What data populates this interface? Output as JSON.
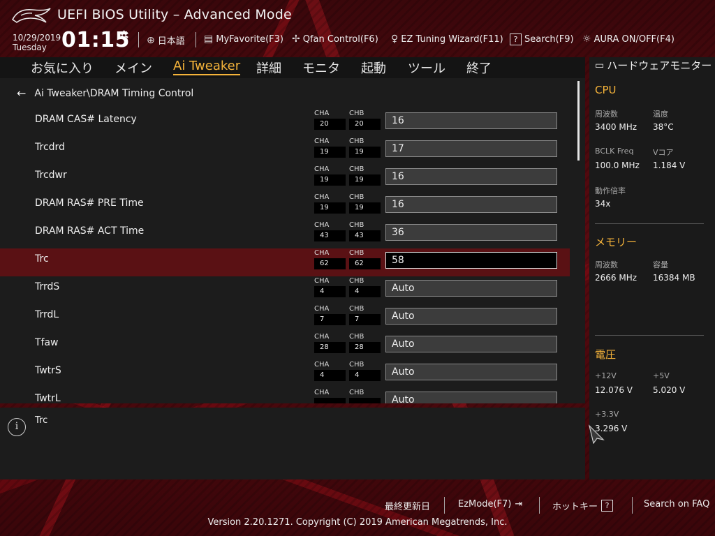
{
  "header": {
    "title": "UEFI BIOS Utility – Advanced Mode",
    "date": "10/29/2019",
    "day": "Tuesday",
    "time": "01:15",
    "tools": [
      {
        "icon": "globe-icon",
        "label": "日本語"
      },
      {
        "icon": "favorite-icon",
        "label": "MyFavorite(F3)"
      },
      {
        "icon": "fan-icon",
        "label": "Qfan Control(F6)"
      },
      {
        "icon": "lightbulb-icon",
        "label": "EZ Tuning Wizard(F11)"
      },
      {
        "icon": "help-box-icon",
        "label": "Search(F9)"
      },
      {
        "icon": "aura-icon",
        "label": "AURA ON/OFF(F4)"
      }
    ]
  },
  "tabs": [
    "お気に入り",
    "メイン",
    "Ai Tweaker",
    "詳細",
    "モニタ",
    "起動",
    "ツール",
    "終了"
  ],
  "active_tab": "Ai Tweaker",
  "breadcrumb": "Ai Tweaker\\DRAM Timing Control",
  "settings": [
    {
      "label": "DRAM CAS# Latency",
      "cha": "20",
      "chb": "20",
      "value": "16"
    },
    {
      "label": "Trcdrd",
      "cha": "19",
      "chb": "19",
      "value": "17"
    },
    {
      "label": "Trcdwr",
      "cha": "19",
      "chb": "19",
      "value": "16"
    },
    {
      "label": "DRAM RAS# PRE Time",
      "cha": "19",
      "chb": "19",
      "value": "16"
    },
    {
      "label": "DRAM RAS# ACT Time",
      "cha": "43",
      "chb": "43",
      "value": "36"
    },
    {
      "label": "Trc",
      "cha": "62",
      "chb": "62",
      "value": "58",
      "selected": true
    },
    {
      "label": "TrrdS",
      "cha": "4",
      "chb": "4",
      "value": "Auto"
    },
    {
      "label": "TrrdL",
      "cha": "7",
      "chb": "7",
      "value": "Auto"
    },
    {
      "label": "Tfaw",
      "cha": "28",
      "chb": "28",
      "value": "Auto"
    },
    {
      "label": "TwtrS",
      "cha": "4",
      "chb": "4",
      "value": "Auto"
    },
    {
      "label": "TwtrL",
      "cha": "",
      "chb": "",
      "value": "Auto"
    }
  ],
  "channel_labels": {
    "a": "CHA",
    "b": "CHB"
  },
  "help_text": "Trc",
  "hw_monitor": {
    "title": "ハードウェアモニター",
    "cpu": {
      "heading": "CPU",
      "freq_label": "周波数",
      "freq": "3400 MHz",
      "temp_label": "温度",
      "temp": "38°C",
      "bclk_label": "BCLK Freq",
      "bclk": "100.0 MHz",
      "vcore_label": "Vコア",
      "vcore": "1.184 V",
      "ratio_label": "動作倍率",
      "ratio": "34x"
    },
    "memory": {
      "heading": "メモリー",
      "freq_label": "周波数",
      "freq": "2666 MHz",
      "cap_label": "容量",
      "cap": "16384 MB"
    },
    "voltage": {
      "heading": "電圧",
      "v12_label": "+12V",
      "v12": "12.076 V",
      "v5_label": "+5V",
      "v5": "5.020 V",
      "v33_label": "+3.3V",
      "v33": "3.296 V"
    }
  },
  "footer": {
    "last_modified": "最終更新日",
    "ezmode": "EzMode(F7)",
    "hotkeys": "ホットキー",
    "faq": "Search on FAQ",
    "copyright": "Version 2.20.1271. Copyright (C) 2019 American Megatrends, Inc."
  },
  "colors": {
    "accent": "#f5b33a",
    "selected_row": "#5a1114",
    "panel": "#1c1c1c"
  }
}
